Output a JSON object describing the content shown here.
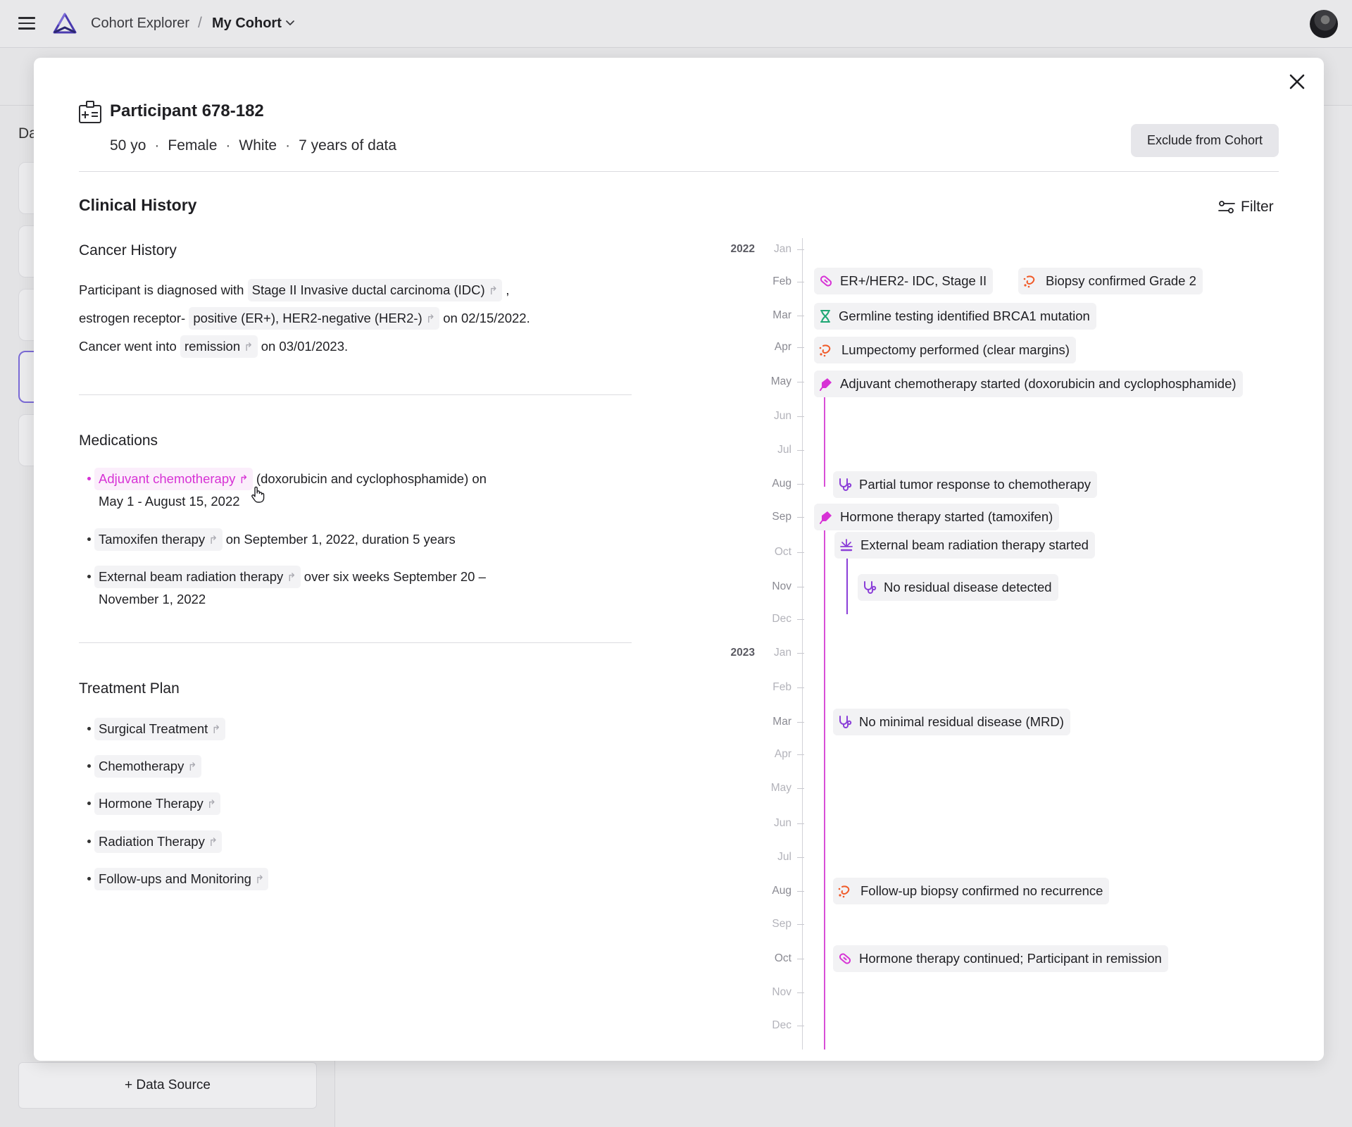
{
  "topbar": {
    "app_name": "Cohort Explorer",
    "separator": "/",
    "cohort_name": "My Cohort"
  },
  "background": {
    "panel_label": "Da",
    "add_source_label": "+ Data Source"
  },
  "participant": {
    "title": "Participant 678-182",
    "age": "50 yo",
    "sex": "Female",
    "race": "White",
    "data_span": "7 years of data",
    "meta_sep": "·",
    "exclude_label": "Exclude from Cohort"
  },
  "clinical": {
    "heading": "Clinical History",
    "filter_label": "Filter"
  },
  "cancer_history": {
    "title": "Cancer History",
    "line1_pre": "Participant is diagnosed with",
    "line1_chip": "Stage II Invasive ductal carcinoma (IDC)",
    "line1_post": ",",
    "line2_pre": "estrogen receptor-",
    "line2_chip": "positive (ER+), HER2-negative (HER2-)",
    "line2_post": "on 02/15/2022.",
    "line3_pre": "Cancer went into",
    "line3_chip": "remission",
    "line3_post": "on 03/01/2023."
  },
  "medications": {
    "title": "Medications",
    "items": [
      {
        "chip": "Adjuvant chemotherapy",
        "text": "(doxorubicin and cyclophosphamide) on",
        "text2": "May 1 - August 15, 2022"
      },
      {
        "chip": "Tamoxifen therapy",
        "text": "on September 1, 2022, duration 5 years"
      },
      {
        "chip": "External beam radiation therapy",
        "text": "over six weeks September 20 –",
        "text2": "November 1, 2022"
      }
    ]
  },
  "treatment_plan": {
    "title": "Treatment Plan",
    "items": [
      "Surgical Treatment",
      "Chemotherapy",
      "Hormone Therapy",
      "Radiation Therapy",
      "Follow-ups and Monitoring"
    ]
  },
  "timeline": {
    "years": [
      "2022",
      "2023"
    ],
    "months": [
      "Jan",
      "Feb",
      "Mar",
      "Apr",
      "May",
      "Jun",
      "Jul",
      "Aug",
      "Sep",
      "Oct",
      "Nov",
      "Dec"
    ],
    "events": [
      {
        "label": "ER+/HER2- IDC, Stage II",
        "icon": "pill-icon",
        "color": "#d732d5"
      },
      {
        "label": "Biopsy confirmed Grade 2",
        "icon": "biopsy-icon",
        "color": "#f05a28"
      },
      {
        "label": "Germline testing identified BRCA1 mutation",
        "icon": "dna-icon",
        "color": "#1fa774"
      },
      {
        "label": "Lumpectomy performed (clear margins)",
        "icon": "biopsy-icon",
        "color": "#f05a28"
      },
      {
        "label": "Adjuvant chemotherapy started (doxorubicin and cyclophosphamide)",
        "icon": "drop-icon",
        "color": "#d732d5"
      },
      {
        "label": "Partial tumor response to chemotherapy",
        "icon": "stethoscope-icon",
        "color": "#8b3fd8"
      },
      {
        "label": "Hormone therapy started (tamoxifen)",
        "icon": "drop-icon",
        "color": "#d732d5"
      },
      {
        "label": "External beam radiation therapy started",
        "icon": "radiation-icon",
        "color": "#8b3fd8"
      },
      {
        "label": "No residual disease detected",
        "icon": "stethoscope-icon",
        "color": "#8b3fd8"
      },
      {
        "label": "No minimal residual disease (MRD)",
        "icon": "stethoscope-icon",
        "color": "#8b3fd8"
      },
      {
        "label": "Follow-up biopsy confirmed no recurrence",
        "icon": "biopsy-icon",
        "color": "#f05a28"
      },
      {
        "label": "Hormone therapy continued; Participant in remission",
        "icon": "pill-icon",
        "color": "#d732d5"
      }
    ]
  }
}
